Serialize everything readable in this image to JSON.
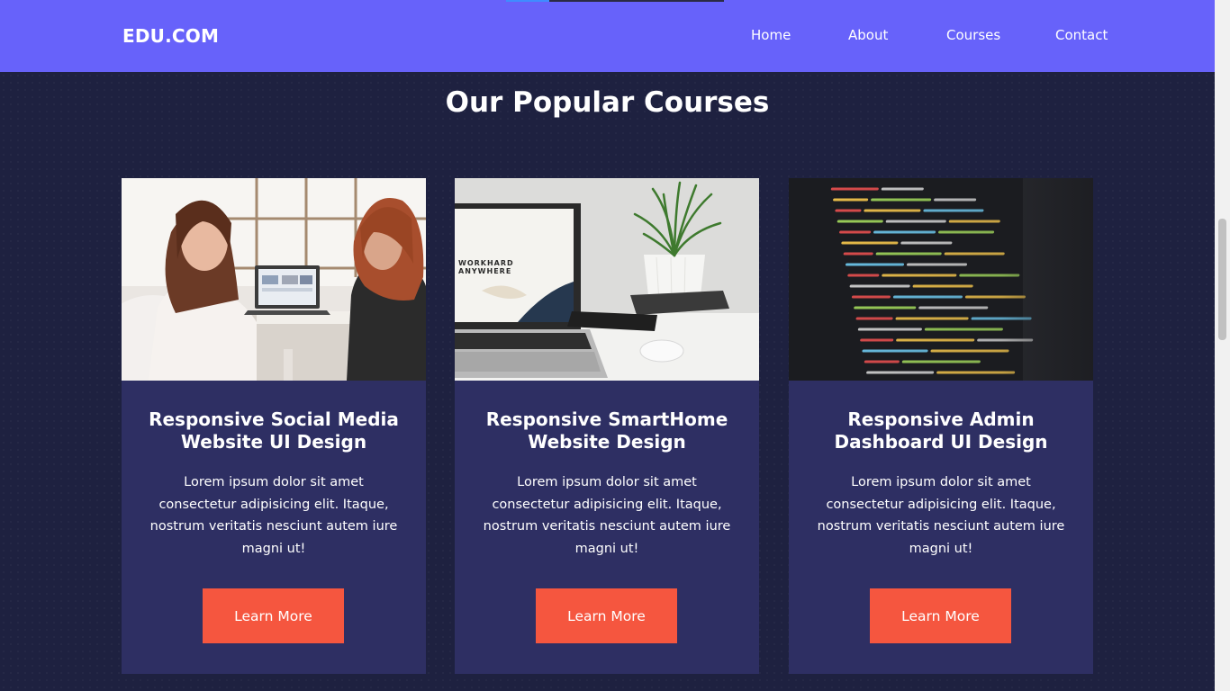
{
  "header": {
    "logo": "EDU.COM",
    "nav": [
      "Home",
      "About",
      "Courses",
      "Contact"
    ]
  },
  "section": {
    "title": "Our Popular Courses"
  },
  "courses": [
    {
      "title": "Responsive Social Media Website UI Design",
      "description": "Lorem ipsum dolor sit amet consectetur adipisicing elit. Itaque, nostrum veritatis nesciunt autem iure magni ut!",
      "button": "Learn More",
      "image": "photo-two-women-with-laptop"
    },
    {
      "title": "Responsive SmartHome Website Design",
      "description": "Lorem ipsum dolor sit amet consectetur adipisicing elit. Itaque, nostrum veritatis nesciunt autem iure magni ut!",
      "button": "Learn More",
      "image": "photo-laptop-plant-desk",
      "screen_text_1": "WORKHARD",
      "screen_text_2": "ANYWHERE"
    },
    {
      "title": "Responsive Admin Dashboard UI Design",
      "description": "Lorem ipsum dolor sit amet consectetur adipisicing elit. Itaque, nostrum veritatis nesciunt autem iure magni ut!",
      "button": "Learn More",
      "image": "photo-code-on-screen"
    }
  ],
  "colors": {
    "navbar": "#6762fa",
    "background": "#1e2140",
    "card": "#2e2f63",
    "button": "#f5563f",
    "text": "#ffffff"
  }
}
